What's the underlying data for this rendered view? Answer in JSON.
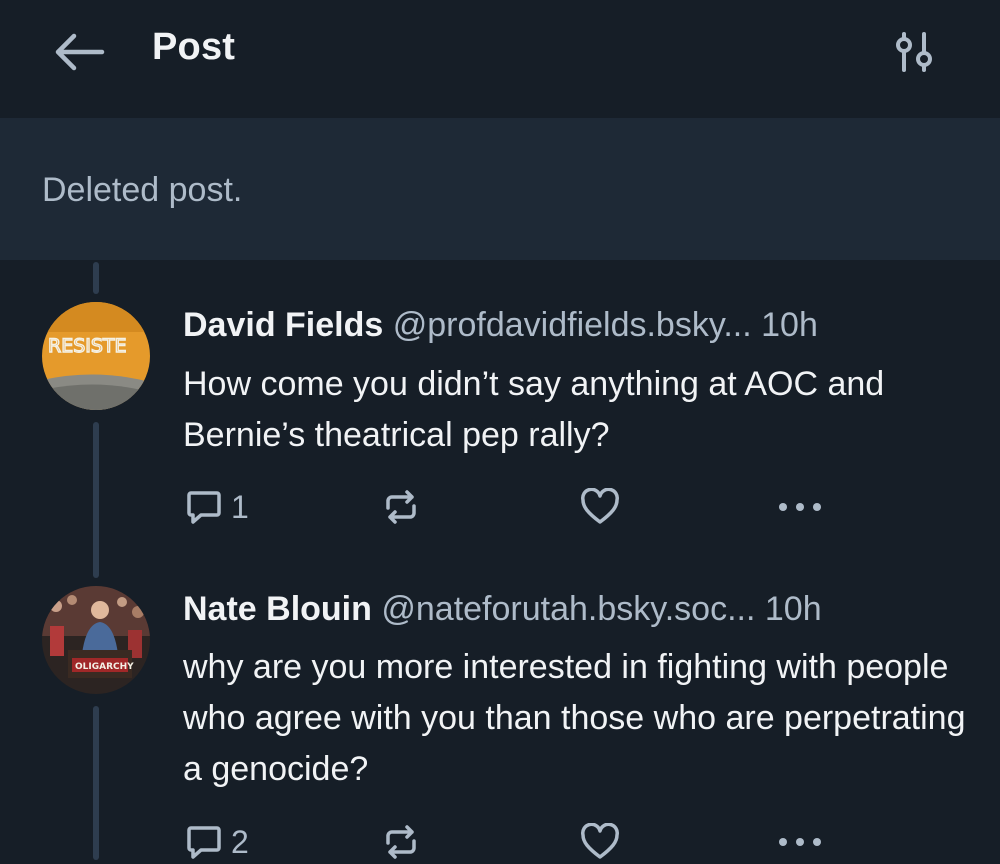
{
  "header": {
    "title": "Post",
    "back_icon": "arrow-left-icon",
    "filter_icon": "sliders-icon"
  },
  "deleted_post": {
    "text": "Deleted post."
  },
  "posts": [
    {
      "author": "David Fields",
      "handle": "@profdavidfields.bsky...",
      "time": "10h",
      "body": "How come you didn’t say anything at AOC and Bernie’s theatrical pep rally?",
      "avatar_text": "RESISTE",
      "reply_count": "1",
      "repost_count": "",
      "like_count": ""
    },
    {
      "author": "Nate Blouin",
      "handle": "@nateforutah.bsky.soc...",
      "time": "10h",
      "body": "why are you more interested in fighting with people who agree with you than those who are perpetrating a genocide?",
      "avatar_text": "OLIGARCHY",
      "reply_count": "2",
      "repost_count": "",
      "like_count": ""
    }
  ],
  "colors": {
    "background": "#161e27",
    "card": "#1e2936",
    "text_primary": "#f1f3f5",
    "text_secondary": "#aebbc9",
    "thread_line": "#2e3d4f"
  }
}
